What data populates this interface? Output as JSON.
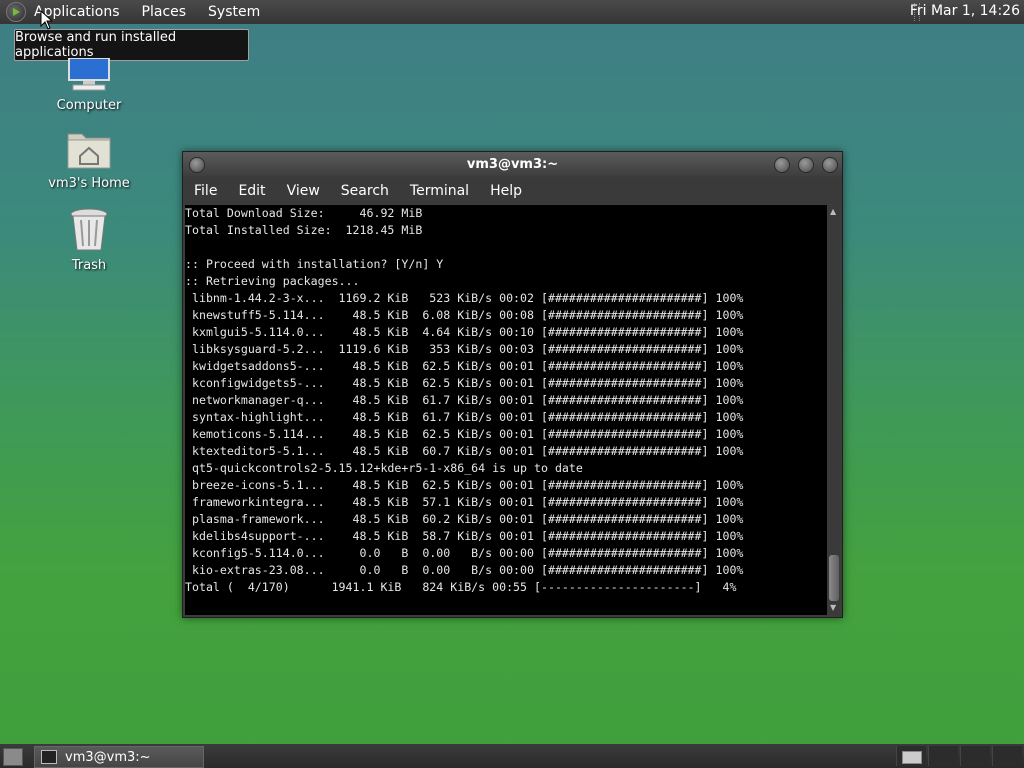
{
  "top_panel": {
    "menus": [
      "Applications",
      "Places",
      "System"
    ],
    "clock": "Fri Mar  1, 14:26"
  },
  "tooltip": {
    "text": "Browse and run installed applications"
  },
  "desktop_icons": [
    {
      "label": "Computer",
      "icon": "computer-icon"
    },
    {
      "label": "vm3's Home",
      "icon": "home-folder-icon"
    },
    {
      "label": "Trash",
      "icon": "trash-icon"
    }
  ],
  "terminal": {
    "title": "vm3@vm3:~",
    "menu": [
      "File",
      "Edit",
      "View",
      "Search",
      "Terminal",
      "Help"
    ],
    "lines": [
      "Total Download Size:     46.92 MiB",
      "Total Installed Size:  1218.45 MiB",
      "",
      ":: Proceed with installation? [Y/n] Y",
      ":: Retrieving packages...",
      " libnm-1.44.2-3-x...  1169.2 KiB   523 KiB/s 00:02 [######################] 100%",
      " knewstuff5-5.114...    48.5 KiB  6.08 KiB/s 00:08 [######################] 100%",
      " kxmlgui5-5.114.0...    48.5 KiB  4.64 KiB/s 00:10 [######################] 100%",
      " libksysguard-5.2...  1119.6 KiB   353 KiB/s 00:03 [######################] 100%",
      " kwidgetsaddons5-...    48.5 KiB  62.5 KiB/s 00:01 [######################] 100%",
      " kconfigwidgets5-...    48.5 KiB  62.5 KiB/s 00:01 [######################] 100%",
      " networkmanager-q...    48.5 KiB  61.7 KiB/s 00:01 [######################] 100%",
      " syntax-highlight...    48.5 KiB  61.7 KiB/s 00:01 [######################] 100%",
      " kemoticons-5.114...    48.5 KiB  62.5 KiB/s 00:01 [######################] 100%",
      " ktexteditor5-5.1...    48.5 KiB  60.7 KiB/s 00:01 [######################] 100%",
      " qt5-quickcontrols2-5.15.12+kde+r5-1-x86_64 is up to date",
      " breeze-icons-5.1...    48.5 KiB  62.5 KiB/s 00:01 [######################] 100%",
      " frameworkintegra...    48.5 KiB  57.1 KiB/s 00:01 [######################] 100%",
      " plasma-framework...    48.5 KiB  60.2 KiB/s 00:01 [######################] 100%",
      " kdelibs4support-...    48.5 KiB  58.7 KiB/s 00:01 [######################] 100%",
      " kconfig5-5.114.0...     0.0   B  0.00   B/s 00:00 [######################] 100%",
      " kio-extras-23.08...     0.0   B  0.00   B/s 00:00 [######################] 100%",
      "Total (  4/170)      1941.1 KiB   824 KiB/s 00:55 [----------------------]   4%"
    ]
  },
  "taskbar": {
    "window_button": "vm3@vm3:~",
    "icons": [
      "show-desktop-icon",
      "terminal-icon",
      "workspace-switcher"
    ]
  }
}
